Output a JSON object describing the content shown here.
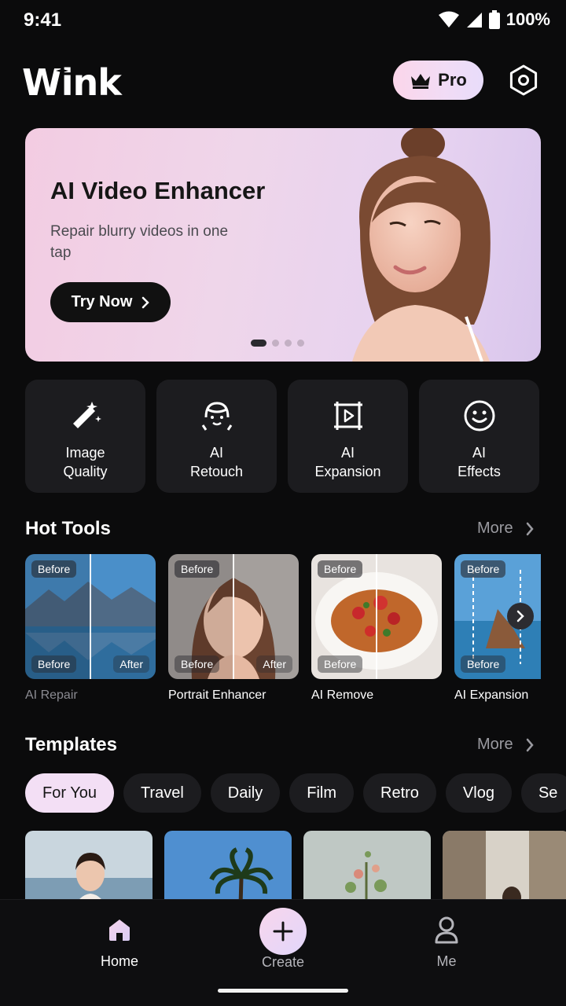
{
  "status": {
    "time": "9:41",
    "battery": "100%"
  },
  "header": {
    "logo": "Wink",
    "pro_label": "Pro"
  },
  "banner": {
    "title": "AI Video Enhancer",
    "subtitle": "Repair blurry videos in one tap",
    "cta": "Try Now",
    "page_count": 4,
    "active_page": 1
  },
  "quick_tools": [
    {
      "label": "Image\nQuality",
      "icon": "magic-wand-icon"
    },
    {
      "label": "AI\nRetouch",
      "icon": "face-retouch-icon"
    },
    {
      "label": "AI\nExpansion",
      "icon": "frame-expand-icon"
    },
    {
      "label": "AI\nEffects",
      "icon": "smiley-icon"
    }
  ],
  "hot_tools": {
    "title": "Hot Tools",
    "more": "More",
    "items": [
      {
        "label": "AI Repair",
        "before": "Before",
        "before2": "Before",
        "after": "After"
      },
      {
        "label": "Portrait Enhancer",
        "before": "Before",
        "before2": "Before",
        "after": "After"
      },
      {
        "label": "AI Remove",
        "before": "Before",
        "before2": "Before"
      },
      {
        "label": "AI Expansion",
        "before": "Before",
        "before2": "Before"
      }
    ]
  },
  "templates": {
    "title": "Templates",
    "more": "More",
    "chips": [
      "For You",
      "Travel",
      "Daily",
      "Film",
      "Retro",
      "Vlog",
      "Se"
    ]
  },
  "nav": {
    "home": "Home",
    "create": "Create",
    "me": "Me"
  },
  "colors": {
    "background": "#0b0b0c",
    "card": "#1c1c1f",
    "pro_gradient_start": "#fbd6ea",
    "pro_gradient_end": "#e8dcfa"
  }
}
